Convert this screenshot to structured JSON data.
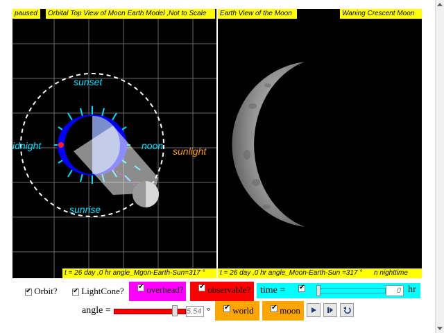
{
  "left_panel": {
    "status": "paused",
    "title": "Orbital Top View of Moon Earth Model ,Not to Scale",
    "labels": {
      "sunset": "sunset",
      "sunrise": "sunrise",
      "midnight": "idnight",
      "noon": "noon",
      "sunlight": "sunlight"
    },
    "footer": "t = 26 day ,0 hr angle_Mgon-Earth-Sun=317 °"
  },
  "right_panel": {
    "title": "Earth View of the Moon",
    "phase": "Waning Crescent Moon",
    "footer": "t = 26 day ,0 hr angle_Moon-Earth-Sun =317 °",
    "footer_right": "n nighttime"
  },
  "controls": {
    "orbit_label": "Orbit?",
    "lightcone_label": "LightCone?",
    "overhead_label": "overhead?",
    "observable_label": "observable?",
    "time_label": "time =",
    "time_value": "0",
    "time_unit": "hr",
    "angle_label": "angle =",
    "angle_value": "5.54",
    "angle_unit": "°",
    "world_label": "world",
    "moon_label": "moon",
    "angle_fraction": 0.88,
    "time_fraction": 0.0
  },
  "colors": {
    "yellow": "#ffff00",
    "cyan": "#00ffff",
    "magenta": "#ff00ff",
    "red": "#ff0000",
    "orange": "#ffa500",
    "sunlight": "#ff9900"
  },
  "icons": [
    "play-icon",
    "step-icon",
    "reset-icon"
  ]
}
